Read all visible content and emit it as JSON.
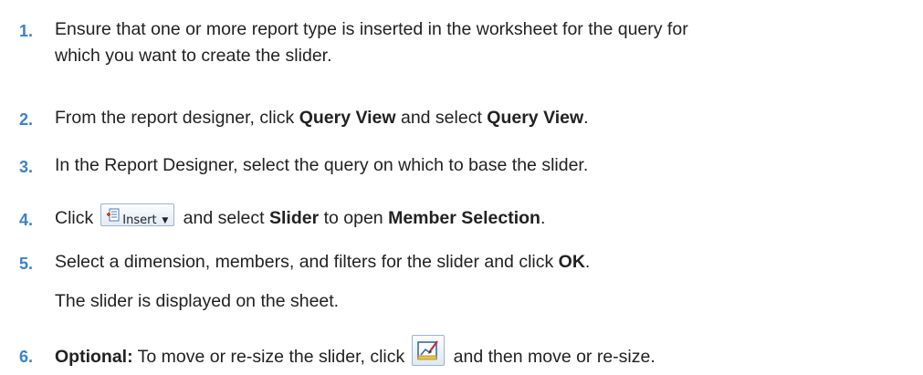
{
  "steps": [
    {
      "number": "1.",
      "line1": "Ensure that one or more report type is inserted in the worksheet for the query for",
      "line2": "which you want to create the slider."
    },
    {
      "number": "2.",
      "prefix": "From the report designer, click ",
      "bold1": "Query View",
      "mid": " and select ",
      "bold2": "Query View",
      "suffix": "."
    },
    {
      "number": "3.",
      "text": "In the Report Designer, select the query on which to base the slider."
    },
    {
      "number": "4.",
      "prefix": "Click",
      "button_label": "Insert",
      "button_icon": "insert-icon",
      "mid": " and select ",
      "bold1": "Slider",
      "mid2": " to open ",
      "bold2": "Member Selection",
      "suffix": "."
    },
    {
      "number": "5.",
      "prefix": "Select a dimension, members, and filters for the slider and click ",
      "bold1": "OK",
      "suffix": ".",
      "result": "The slider is displayed on the sheet."
    },
    {
      "number": "6.",
      "bold_prefix": "Optional:",
      "prefix": " To move or re-size the slider, click",
      "button_icon": "move-resize-icon",
      "suffix": " and then move or re-size."
    }
  ],
  "colors": {
    "step_number": "#3d82c4",
    "text": "#222222"
  }
}
